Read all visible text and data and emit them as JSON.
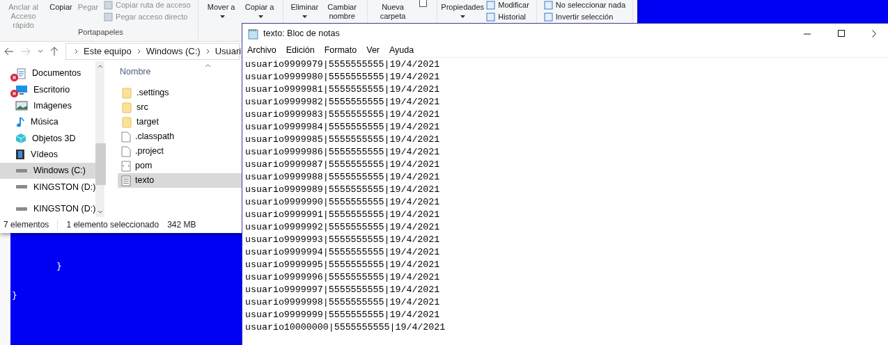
{
  "explorer": {
    "ribbon": {
      "items": [
        {
          "kind": "big",
          "label": "Anclar al Acceso rápido",
          "disabled": true
        },
        {
          "kind": "big",
          "label": "Copiar",
          "disabled": false
        },
        {
          "kind": "big",
          "label": "Pegar",
          "disabled": true
        },
        {
          "kind": "stack",
          "entries": [
            "Copiar ruta de acceso",
            "Pegar acceso directo"
          ],
          "disabled": true
        },
        {
          "kind": "sep"
        },
        {
          "kind": "split",
          "label": "Mover a",
          "disabled": false
        },
        {
          "kind": "split",
          "label": "Copiar a",
          "disabled": false
        },
        {
          "kind": "sep"
        },
        {
          "kind": "dropdown",
          "label": "Eliminar",
          "disabled": false
        },
        {
          "kind": "big",
          "label": "Cambiar nombre",
          "disabled": false
        },
        {
          "kind": "sep"
        },
        {
          "kind": "big",
          "label": "Nueva carpeta",
          "disabled": false
        },
        {
          "kind": "check",
          "checked": false
        },
        {
          "kind": "sep"
        },
        {
          "kind": "dropdown",
          "label": "Propiedades",
          "disabled": false
        },
        {
          "kind": "stack",
          "entries": [
            "Modificar",
            "Historial"
          ],
          "disabled": false
        },
        {
          "kind": "sep"
        },
        {
          "kind": "stack",
          "entries": [
            "No seleccionar nada",
            "Invertir selección"
          ],
          "disabled": false
        },
        {
          "kind": "sep"
        }
      ],
      "group_label": "Portapapeles"
    },
    "breadcrumb": [
      "Este equipo",
      "Windows (C:)",
      "Usuari"
    ],
    "nav_items": [
      {
        "label": "Documentos",
        "kind": "documents",
        "error": true,
        "selected": false
      },
      {
        "label": "Escritorio",
        "kind": "desktop",
        "error": true,
        "selected": false
      },
      {
        "label": "Imágenes",
        "kind": "pictures",
        "error": false,
        "selected": false
      },
      {
        "label": "Música",
        "kind": "music",
        "error": false,
        "selected": false
      },
      {
        "label": "Objetos 3D",
        "kind": "cube",
        "error": false,
        "selected": false
      },
      {
        "label": "Vídeos",
        "kind": "videos",
        "error": false,
        "selected": false
      },
      {
        "label": "Windows (C:)",
        "kind": "drive",
        "error": false,
        "selected": true
      },
      {
        "label": "KINGSTON (D:)",
        "kind": "drive",
        "error": false,
        "selected": false
      },
      {
        "label": "KINGSTON (D:)",
        "kind": "drive",
        "error": false,
        "selected": false
      }
    ],
    "column_header": "Nombre",
    "files": [
      {
        "name": ".settings",
        "kind": "folder",
        "selected": false
      },
      {
        "name": "src",
        "kind": "folder",
        "selected": false
      },
      {
        "name": "target",
        "kind": "folder",
        "selected": false
      },
      {
        "name": ".classpath",
        "kind": "file",
        "selected": false
      },
      {
        "name": ".project",
        "kind": "file",
        "selected": false
      },
      {
        "name": "pom",
        "kind": "xml",
        "selected": false
      },
      {
        "name": "texto",
        "kind": "text",
        "selected": true
      }
    ],
    "status_bar": {
      "count": "7 elementos",
      "selection": "1 elemento seleccionado",
      "size": "342 MB"
    }
  },
  "editor_background": {
    "lines": [
      "}",
      "}"
    ]
  },
  "notepad": {
    "title": "texto: Bloc de notas",
    "menu": [
      "Archivo",
      "Edición",
      "Formato",
      "Ver",
      "Ayuda"
    ],
    "lines": [
      "usuario9999979|5555555555|19/4/2021",
      "usuario9999980|5555555555|19/4/2021",
      "usuario9999981|5555555555|19/4/2021",
      "usuario9999982|5555555555|19/4/2021",
      "usuario9999983|5555555555|19/4/2021",
      "usuario9999984|5555555555|19/4/2021",
      "usuario9999985|5555555555|19/4/2021",
      "usuario9999986|5555555555|19/4/2021",
      "usuario9999987|5555555555|19/4/2021",
      "usuario9999988|5555555555|19/4/2021",
      "usuario9999989|5555555555|19/4/2021",
      "usuario9999990|5555555555|19/4/2021",
      "usuario9999991|5555555555|19/4/2021",
      "usuario9999992|5555555555|19/4/2021",
      "usuario9999993|5555555555|19/4/2021",
      "usuario9999994|5555555555|19/4/2021",
      "usuario9999995|5555555555|19/4/2021",
      "usuario9999996|5555555555|19/4/2021",
      "usuario9999997|5555555555|19/4/2021",
      "usuario9999998|5555555555|19/4/2021",
      "usuario9999999|5555555555|19/4/2021",
      "usuario10000000|5555555555|19/4/2021"
    ]
  }
}
